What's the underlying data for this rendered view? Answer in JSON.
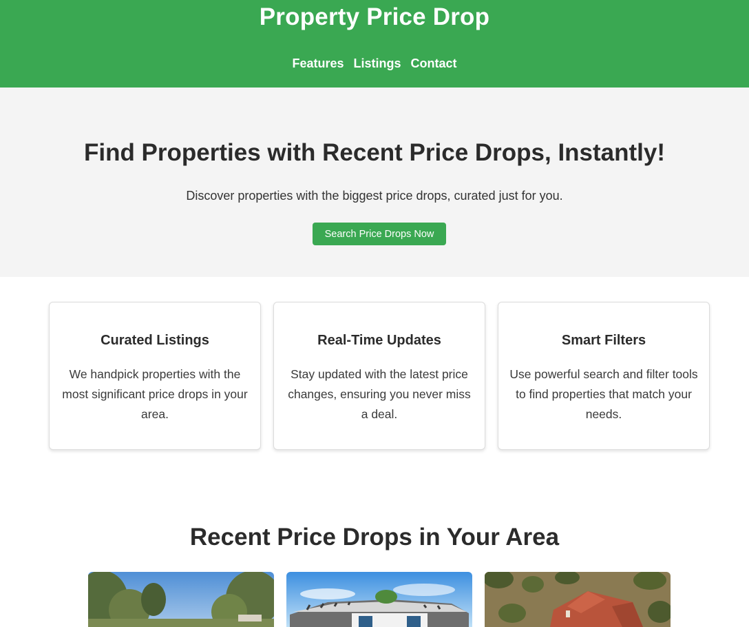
{
  "header": {
    "title": "Property Price Drop",
    "nav": [
      "Features",
      "Listings",
      "Contact"
    ]
  },
  "hero": {
    "title": "Find Properties with Recent Price Drops, Instantly!",
    "subtitle": "Discover properties with the biggest price drops, curated just for you.",
    "cta_label": "Search Price Drops Now"
  },
  "features": [
    {
      "title": "Curated Listings",
      "text": "We handpick properties with the most significant price drops in your area."
    },
    {
      "title": "Real-Time Updates",
      "text": "Stay updated with the latest price changes, ensuring you never miss a deal."
    },
    {
      "title": "Smart Filters",
      "text": "Use powerful search and filter tools to find properties that match your needs."
    }
  ],
  "listings": {
    "title": "Recent Price Drops in Your Area"
  },
  "colors": {
    "brand_green": "#3aa852",
    "hero_bg": "#f4f4f4",
    "text_dark": "#2b2b2b"
  }
}
